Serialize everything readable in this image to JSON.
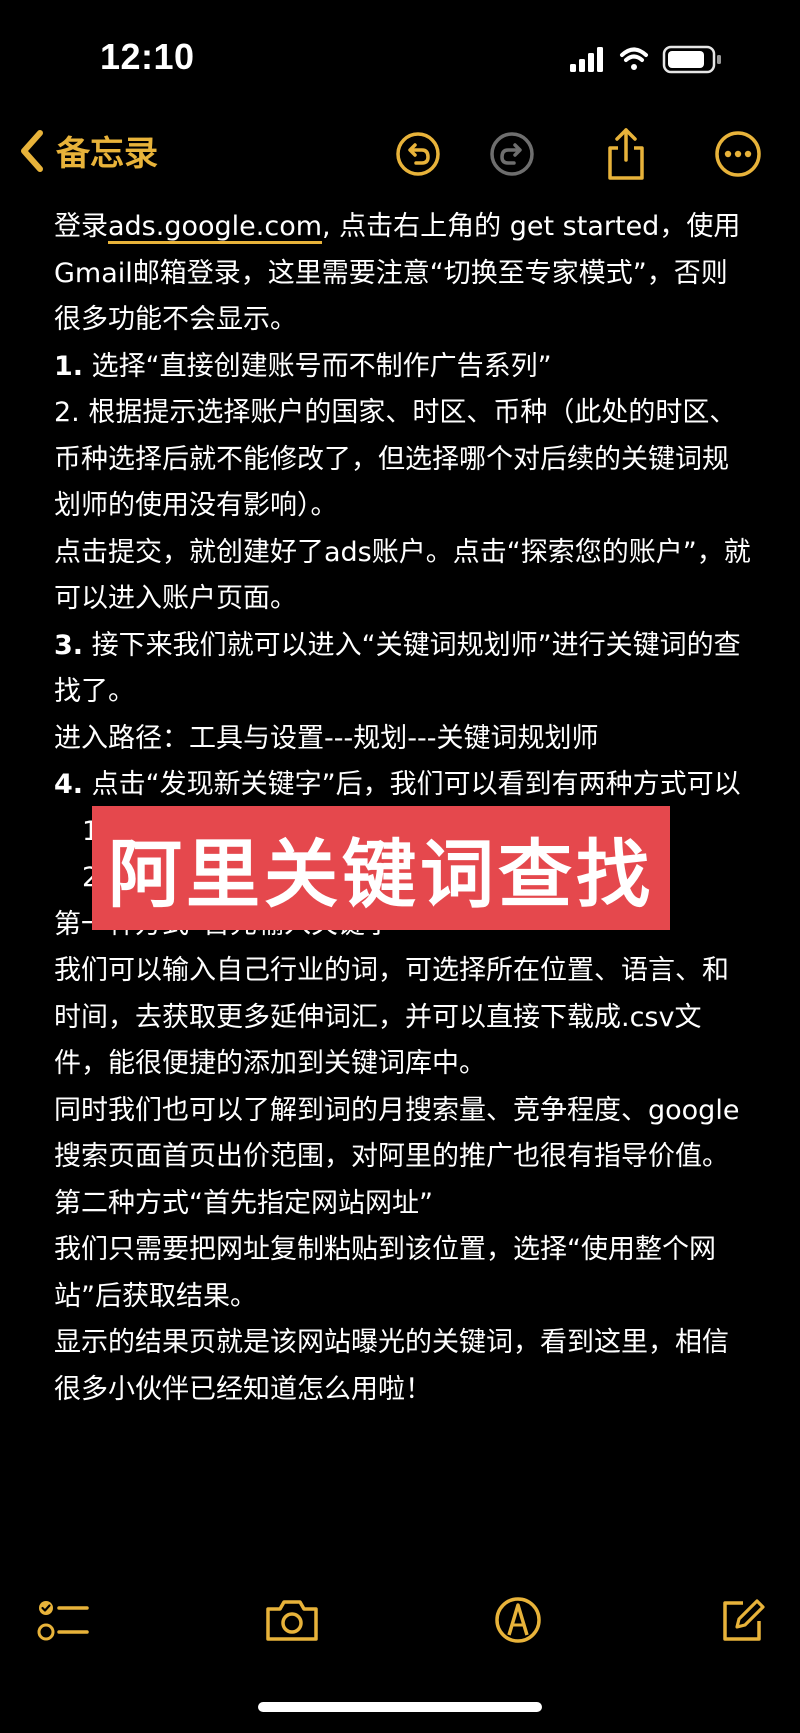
{
  "status_bar": {
    "time": "12:10",
    "icons": [
      "cellular-signal-icon",
      "wifi-icon",
      "battery-icon"
    ]
  },
  "nav": {
    "back_label": "备忘录",
    "icons": [
      "chevron-left-icon",
      "undo-icon",
      "redo-icon",
      "share-icon",
      "more-icon"
    ]
  },
  "colors": {
    "accent": "#e8b33a",
    "background": "#000000",
    "text": "#ffffff",
    "banner": "#e5484d",
    "disabled": "#6e6e6e"
  },
  "note": {
    "intro_prefix": "登录",
    "intro_link": "ads.google.com",
    "intro_suffix": ", 点击右上角的 get started，使用Gmail邮箱登录，这里需要注意“切换至专家模式”，否则很多功能不会显示。",
    "step1_num": "1.",
    "step1_text": " 选择“直接创建账号而不制作广告系列”",
    "step2_num": "2.",
    "step2_text": " 根据提示选择账户的国家、时区、币种（此处的时区、币种选择后就不能修改了，但选择哪个对后续的关键词规划师的使用没有影响）。",
    "submit_text": "点击提交，就创建好了ads账户。点击“探索您的账户”，就可以进入账户页面。",
    "step3_num": "3.",
    "step3_text": " 接下来我们就可以进入“关键词规划师”进行关键词的查找了。",
    "path_text": "进入路径：工具与设置---规划---关键词规划师",
    "step4_num": "4.",
    "step4_text": " 点击“发现新关键字”后，我们可以看到有两种方式可以",
    "sub1": "1.",
    "sub2": "2.",
    "method1_title": "第一种方式“首先输入关键字”",
    "method1_p1": "我们可以输入自己行业的词，可选择所在位置、语言、和时间，去获取更多延伸词汇，并可以直接下载成.csv文件，能很便捷的添加到关键词库中。",
    "method1_p2": "同时我们也可以了解到词的月搜索量、竞争程度、google 搜索页面首页出价范围，对阿里的推广也很有指导价值。",
    "method2_title": "第二种方式“首先指定网站网址”",
    "method2_p1": "我们只需要把网址复制粘贴到该位置，选择“使用整个网站”后获取结果。",
    "method2_p2": "显示的结果页就是该网站曝光的关键词，看到这里，相信很多小伙伴已经知道怎么用啦！"
  },
  "banner": {
    "text": "阿里关键词查找"
  },
  "toolbar": {
    "icons": [
      "checklist-icon",
      "camera-icon",
      "markup-pen-icon",
      "compose-icon"
    ]
  }
}
